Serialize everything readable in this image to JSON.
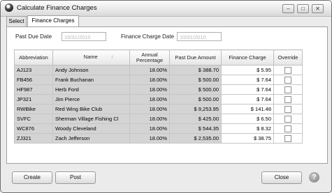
{
  "window": {
    "title": "Calculate Finance Charges"
  },
  "tabs": [
    {
      "label": "Select"
    },
    {
      "label": "Finance Charges"
    }
  ],
  "fields": {
    "past_due_date_label": "Past Due Date",
    "past_due_date_value": "10/31/2010",
    "finance_charge_date_label": "Finance Charge Date",
    "finance_charge_date_value": "10/31/2010"
  },
  "grid": {
    "columns": [
      "Abbreviation",
      "Name",
      "Annual Percentage",
      "Past Due Amount",
      "Finance Charge",
      "Override"
    ],
    "rows": [
      {
        "abbr": "AJ123",
        "name": "Andy Johnson",
        "pct": "18.00%",
        "past_due": "$ 388.70",
        "charge": "$ 5.95"
      },
      {
        "abbr": "FB456",
        "name": "Frank Buchanan",
        "pct": "18.00%",
        "past_due": "$ 500.00",
        "charge": "$ 7.64"
      },
      {
        "abbr": "HF987",
        "name": "Herb Ford",
        "pct": "18.00%",
        "past_due": "$ 500.00",
        "charge": "$ 7.64"
      },
      {
        "abbr": "JP321",
        "name": "Jim Pierce",
        "pct": "18.00%",
        "past_due": "$ 500.00",
        "charge": "$ 7.64"
      },
      {
        "abbr": "RWBike",
        "name": "Red Wing Bike Club",
        "pct": "18.00%",
        "past_due": "$ 9,253.95",
        "charge": "$ 141.48"
      },
      {
        "abbr": "SVFC",
        "name": "Sherman Village Fishing Cl",
        "pct": "18.00%",
        "past_due": "$ 425.00",
        "charge": "$ 6.50"
      },
      {
        "abbr": "WC876",
        "name": "Woody Cleveland",
        "pct": "18.00%",
        "past_due": "$ 544.35",
        "charge": "$ 8.32"
      },
      {
        "abbr": "ZJ321",
        "name": "Zach Jefferson",
        "pct": "18.00%",
        "past_due": "$ 2,535.00",
        "charge": "$ 38.75"
      }
    ]
  },
  "buttons": {
    "create": "Create",
    "post": "Post",
    "close": "Close",
    "help": "?"
  },
  "titlebar_buttons": {
    "minimize": "–",
    "maximize": "□",
    "close": "✕"
  }
}
